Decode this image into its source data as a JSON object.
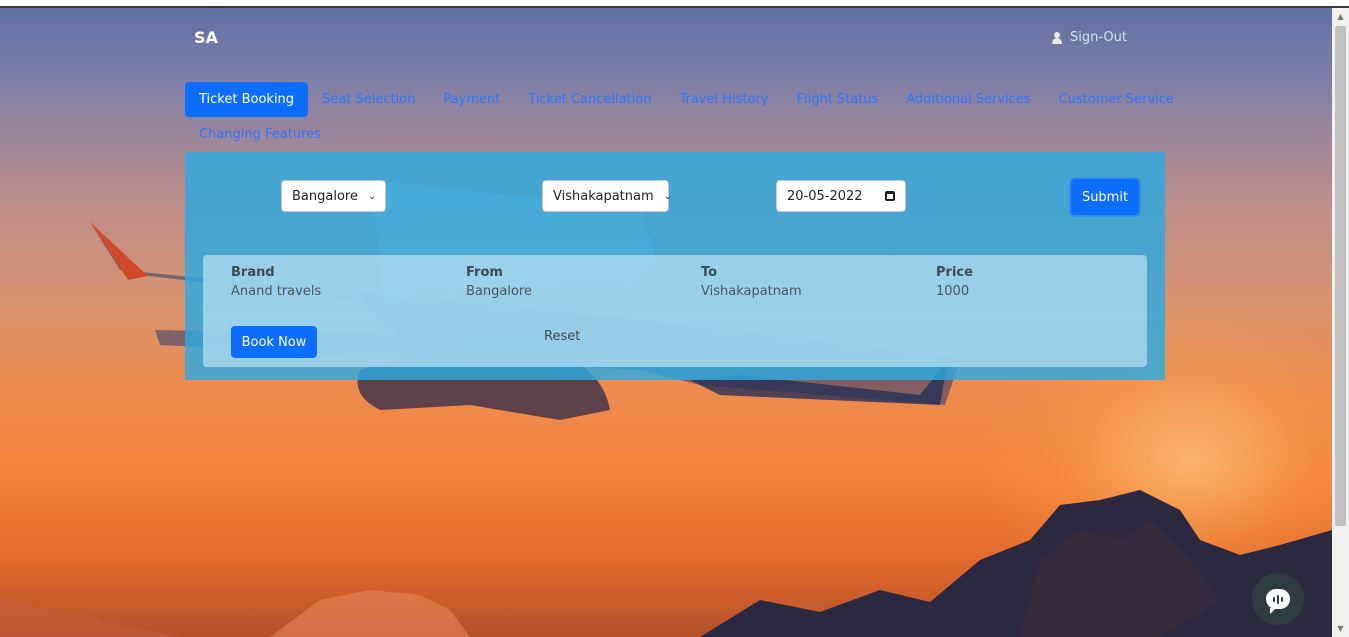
{
  "header": {
    "brand": "SA",
    "signout_label": "Sign-Out"
  },
  "nav": {
    "items": [
      {
        "label": "Ticket Booking"
      },
      {
        "label": "Seat Selection"
      },
      {
        "label": "Payment"
      },
      {
        "label": "Ticket Cancellation"
      },
      {
        "label": "Travel History"
      },
      {
        "label": "Flight Status"
      },
      {
        "label": "Additional Services"
      },
      {
        "label": "Customer Service"
      },
      {
        "label": "Changing Features"
      }
    ]
  },
  "search": {
    "from_value": "Bangalore",
    "to_value": "Vishakapatnam",
    "date_value": "20-05-2022",
    "submit_label": "Submit"
  },
  "result": {
    "headers": {
      "brand": "Brand",
      "from": "From",
      "to": "To",
      "price": "Price"
    },
    "row": {
      "brand": "Anand travels",
      "from": "Bangalore",
      "to": "Vishakapatnam",
      "price": "1000"
    },
    "book_label": "Book Now",
    "reset_label": "Reset"
  },
  "colors": {
    "accent": "#0d6efd",
    "nav_link": "#2f74ff",
    "panel": "#2daae1"
  },
  "icons": {
    "user": "user-icon",
    "calendar": "calendar-icon",
    "chevron": "chevron-down-icon",
    "chat": "chat-icon"
  }
}
